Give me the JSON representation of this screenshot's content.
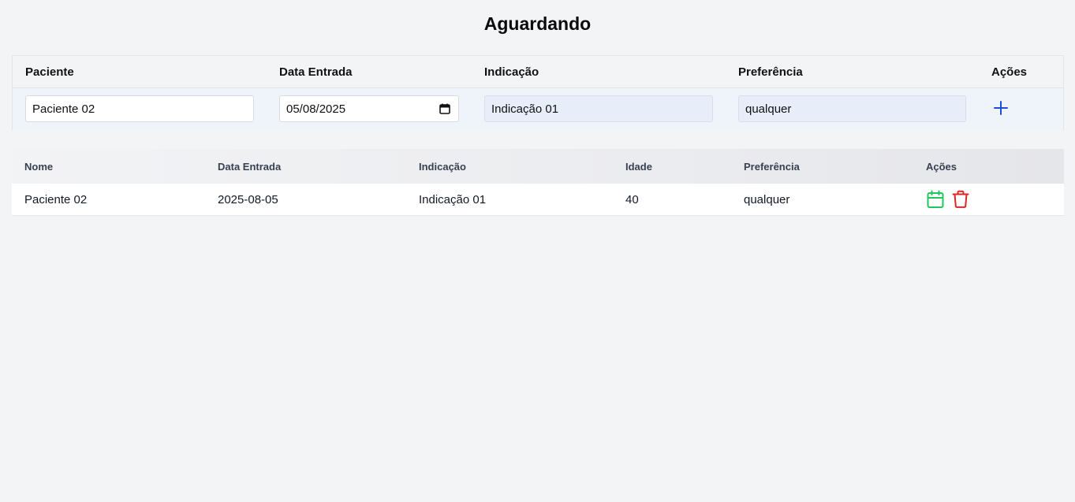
{
  "page": {
    "title": "Aguardando"
  },
  "form": {
    "headers": {
      "paciente": "Paciente",
      "data_entrada": "Data Entrada",
      "indicacao": "Indicação",
      "preferencia": "Preferência",
      "acoes": "Ações"
    },
    "values": {
      "paciente": "Paciente 02",
      "data_entrada": "05/08/2025",
      "indicacao": "Indicação 01",
      "preferencia": "qualquer"
    },
    "add_icon": "plus-icon",
    "accent_color": "#1d4ed8"
  },
  "table": {
    "headers": {
      "nome": "Nome",
      "data_entrada": "Data Entrada",
      "indicacao": "Indicação",
      "idade": "Idade",
      "preferencia": "Preferência",
      "acoes": "Ações"
    },
    "rows": [
      {
        "nome": "Paciente 02",
        "data_entrada": "2025-08-05",
        "indicacao": "Indicação 01",
        "idade": "40",
        "preferencia": "qualquer",
        "actions": [
          "calendar-icon",
          "trash-icon"
        ]
      }
    ],
    "colors": {
      "schedule": "#22c55e",
      "delete": "#dc2626"
    }
  }
}
